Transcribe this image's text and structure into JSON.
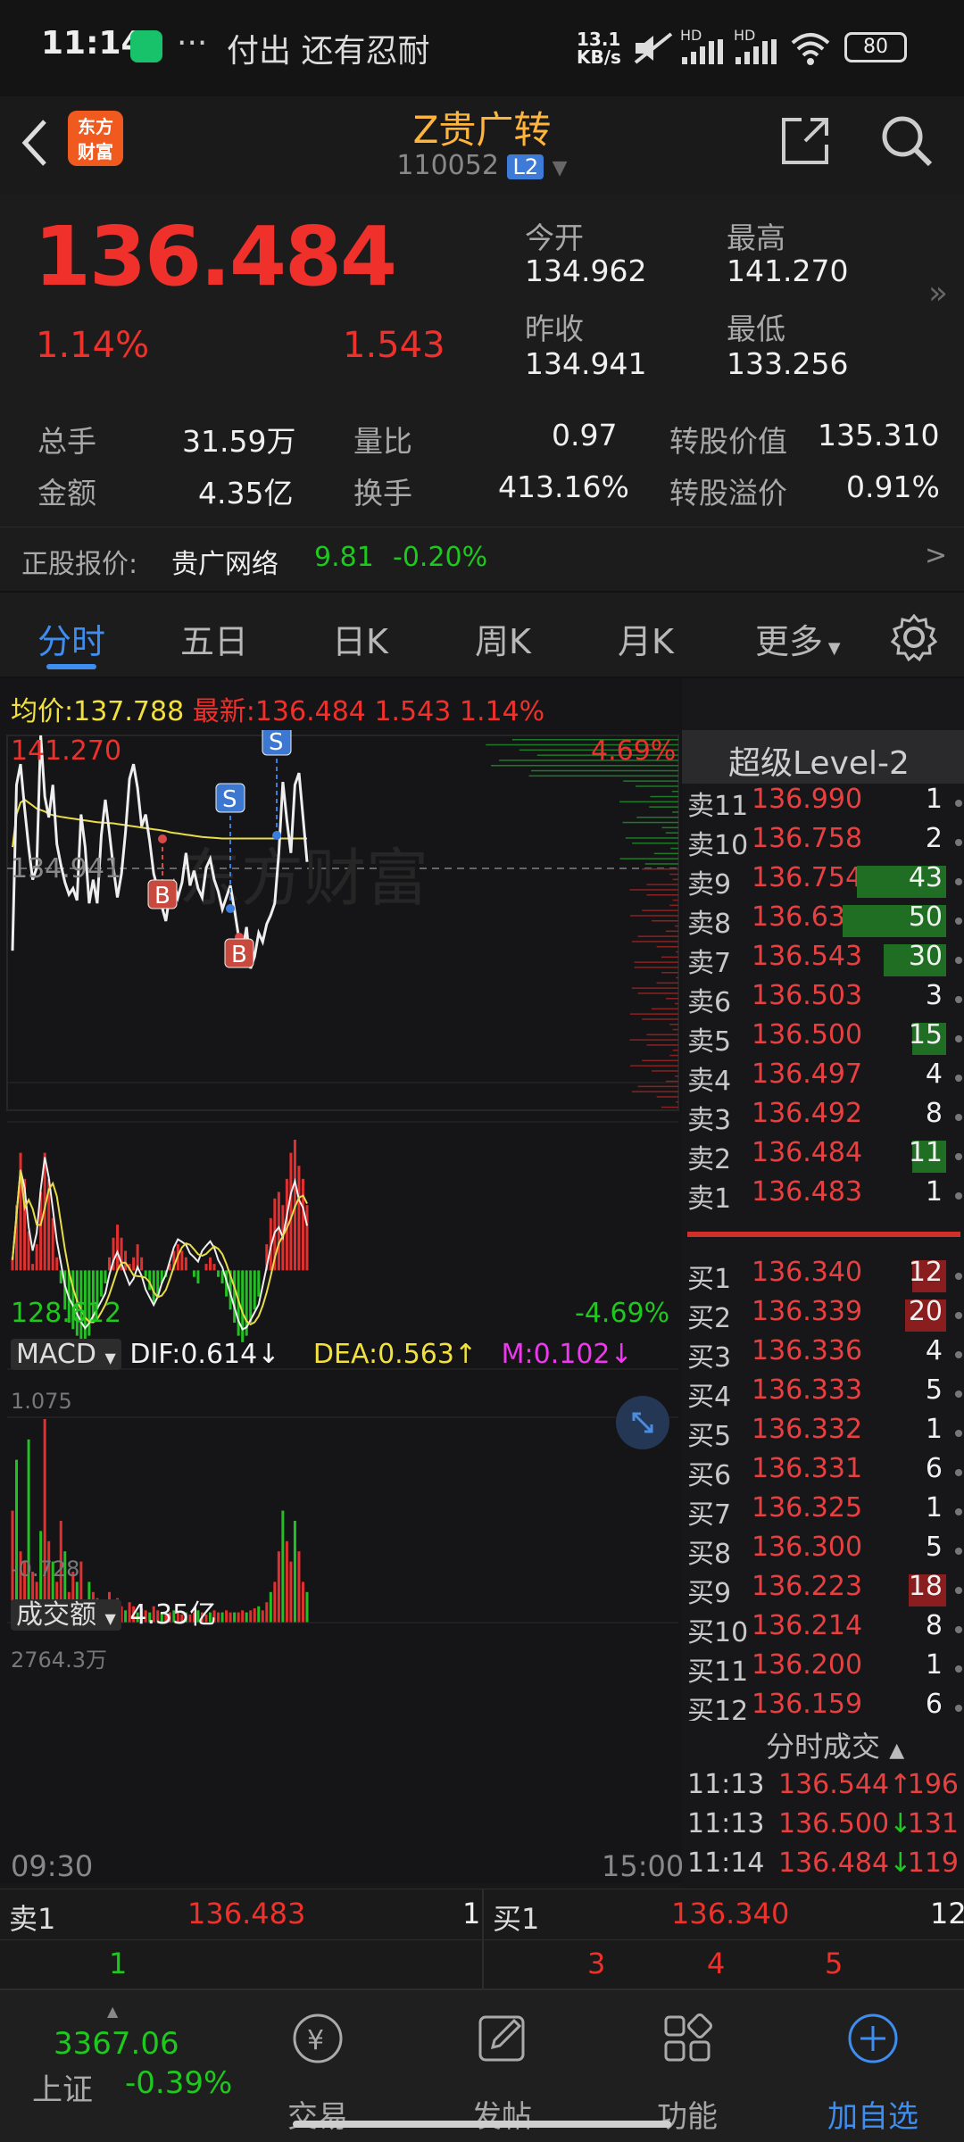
{
  "status_bar": {
    "time": "11:14",
    "ticker_text": "付出 还有忍耐",
    "net_speed_value": "13.1",
    "net_speed_unit": "KB/s",
    "battery": "80",
    "hd1": "HD",
    "hd2": "HD"
  },
  "header": {
    "logo_line1": "东方",
    "logo_line2": "财富",
    "title": "Z贵广转",
    "code": "110052",
    "level_badge": "L2"
  },
  "quote": {
    "price": "136.484",
    "change_pct": "1.14%",
    "change": "1.543",
    "open_label": "今开",
    "open": "134.962",
    "high_label": "最高",
    "high": "141.270",
    "prev_close_label": "昨收",
    "prev_close": "134.941",
    "low_label": "最低",
    "low": "133.256",
    "stats": [
      {
        "label": "总手",
        "value": "31.59万"
      },
      {
        "label": "量比",
        "value": "0.97"
      },
      {
        "label": "转股价值",
        "value": "135.310"
      },
      {
        "label": "金额",
        "value": "4.35亿"
      },
      {
        "label": "换手",
        "value": "413.16%"
      },
      {
        "label": "转股溢价",
        "value": "0.91%"
      }
    ]
  },
  "underlying": {
    "label": "正股报价:",
    "name": "贵广网络",
    "price": "9.81",
    "change": "-0.20%"
  },
  "tabs": [
    "分时",
    "五日",
    "日K",
    "周K",
    "月K",
    "更多"
  ],
  "chart": {
    "avg_label": "均价:",
    "avg": "137.788",
    "latest_label": "最新:",
    "latest": "136.484",
    "latest_change": "1.543",
    "latest_pct": "1.14%",
    "y_top": "141.270",
    "y_mid": "134.941",
    "y_bottom": "128.612",
    "pct_top": "4.69%",
    "pct_bottom": "-4.69%",
    "watermark": "东方财富",
    "macd_label": "MACD",
    "dif": "DIF:0.614↓",
    "dea": "DEA:0.563↑",
    "m": "M:0.102↓",
    "macd_top": "1.075",
    "macd_bottom": "-0.728",
    "vol_label": "成交额",
    "vol_total": "4.35亿",
    "vol_top": "2764.3万",
    "time_start": "09:30",
    "time_end": "15:00",
    "markers": {
      "buy": "B",
      "sell": "S"
    }
  },
  "level2": {
    "title": "超级Level-2",
    "asks": [
      {
        "name": "卖11",
        "price": "136.990",
        "qty": "1",
        "bar": 0
      },
      {
        "name": "卖10",
        "price": "136.758",
        "qty": "2",
        "bar": 0
      },
      {
        "name": "卖9",
        "price": "136.754",
        "qty": "43",
        "bar": 0.86
      },
      {
        "name": "卖8",
        "price": "136.638",
        "qty": "50",
        "bar": 1.0
      },
      {
        "name": "卖7",
        "price": "136.543",
        "qty": "30",
        "bar": 0.6
      },
      {
        "name": "卖6",
        "price": "136.503",
        "qty": "3",
        "bar": 0
      },
      {
        "name": "卖5",
        "price": "136.500",
        "qty": "15",
        "bar": 0.3
      },
      {
        "name": "卖4",
        "price": "136.497",
        "qty": "4",
        "bar": 0
      },
      {
        "name": "卖3",
        "price": "136.492",
        "qty": "8",
        "bar": 0
      },
      {
        "name": "卖2",
        "price": "136.484",
        "qty": "11",
        "bar": 0.22
      },
      {
        "name": "卖1",
        "price": "136.483",
        "qty": "1",
        "bar": 0
      }
    ],
    "bids": [
      {
        "name": "买1",
        "price": "136.340",
        "qty": "12",
        "bar": 0.24
      },
      {
        "name": "买2",
        "price": "136.339",
        "qty": "20",
        "bar": 0.4
      },
      {
        "name": "买3",
        "price": "136.336",
        "qty": "4",
        "bar": 0
      },
      {
        "name": "买4",
        "price": "136.333",
        "qty": "5",
        "bar": 0
      },
      {
        "name": "买5",
        "price": "136.332",
        "qty": "1",
        "bar": 0
      },
      {
        "name": "买6",
        "price": "136.331",
        "qty": "6",
        "bar": 0
      },
      {
        "name": "买7",
        "price": "136.325",
        "qty": "1",
        "bar": 0
      },
      {
        "name": "买8",
        "price": "136.300",
        "qty": "5",
        "bar": 0
      },
      {
        "name": "买9",
        "price": "136.223",
        "qty": "18",
        "bar": 0.36
      },
      {
        "name": "买10",
        "price": "136.214",
        "qty": "8",
        "bar": 0
      },
      {
        "name": "买11",
        "price": "136.200",
        "qty": "1",
        "bar": 0
      },
      {
        "name": "买12",
        "price": "136.159",
        "qty": "6",
        "bar": 0
      }
    ],
    "ticks_title": "分时成交",
    "ticks": [
      {
        "time": "11:13",
        "price": "136.544↑",
        "qty": "196"
      },
      {
        "time": "11:13",
        "price": "136.500↓",
        "qty": "131"
      },
      {
        "time": "11:14",
        "price": "136.484↓",
        "qty": "119"
      }
    ]
  },
  "bottom_orderbook": {
    "ask_label": "卖1",
    "ask_price": "136.483",
    "ask_qty": "1",
    "bid_label": "买1",
    "bid_price": "136.340",
    "bid_qty": "12",
    "row2_left": "1",
    "row2_right": [
      "3",
      "4",
      "5"
    ]
  },
  "nav": {
    "index_value": "3367.06",
    "index_name": "上证",
    "index_change": "-0.39%",
    "items": [
      "交易",
      "发帖",
      "功能",
      "加自选"
    ]
  },
  "colors": {
    "up": "#f0302a",
    "down": "#1ec81e",
    "accent": "#3e8df0",
    "avg_line": "#f2e13c",
    "title": "#ffb43c"
  }
}
